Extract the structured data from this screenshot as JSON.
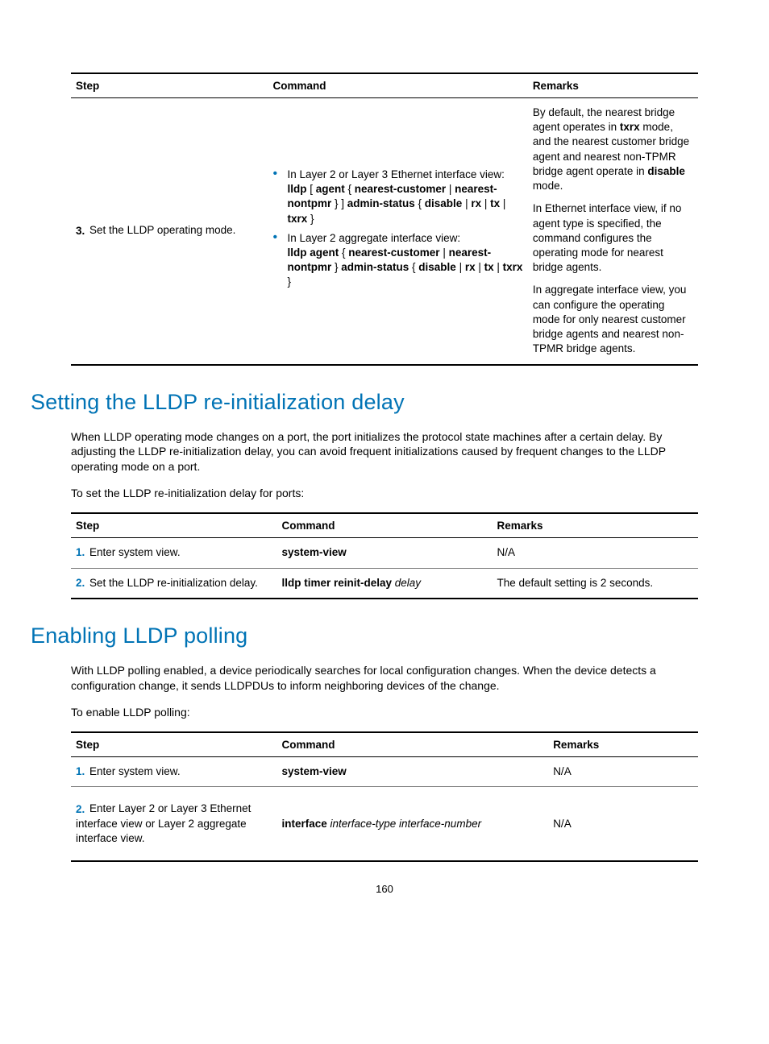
{
  "page_number": "160",
  "table1": {
    "headers": {
      "step": "Step",
      "command": "Command",
      "remarks": "Remarks"
    },
    "row": {
      "num": "3.",
      "step_text": "Set the LLDP operating mode.",
      "cmd_li1_pre": "In Layer 2 or Layer 3 Ethernet interface view:",
      "cmd_li1_code_a": "lldp",
      "cmd_li1_code_b": " [ ",
      "cmd_li1_code_c": "agent",
      "cmd_li1_code_d": " { ",
      "cmd_li1_code_e": "nearest-customer",
      "cmd_li1_code_f": " | ",
      "cmd_li1_code_g": "nearest-nontpmr",
      "cmd_li1_code_h": " } ] ",
      "cmd_li1_code_i": "admin-status",
      "cmd_li1_code_j": " { ",
      "cmd_li1_code_k": "disable",
      "cmd_li1_code_l": " | ",
      "cmd_li1_code_m": "rx",
      "cmd_li1_code_n": " | ",
      "cmd_li1_code_o": "tx",
      "cmd_li1_code_p": " | ",
      "cmd_li1_code_q": "txrx",
      "cmd_li1_code_r": " }",
      "cmd_li2_pre": "In Layer 2 aggregate interface view:",
      "cmd_li2_code_a": "lldp agent",
      "cmd_li2_code_b": " { ",
      "cmd_li2_code_c": "nearest-customer",
      "cmd_li2_code_d": " | ",
      "cmd_li2_code_e": "nearest-nontpmr",
      "cmd_li2_code_f": " } ",
      "cmd_li2_code_g": "admin-status",
      "cmd_li2_code_h": " { ",
      "cmd_li2_code_i": "disable",
      "cmd_li2_code_j": " | ",
      "cmd_li2_code_k": "rx",
      "cmd_li2_code_l": " | ",
      "cmd_li2_code_m": "tx",
      "cmd_li2_code_n": " | ",
      "cmd_li2_code_o": "txrx",
      "cmd_li2_code_p": " }",
      "rem_p1_a": "By default, the nearest bridge agent operates in ",
      "rem_p1_b": "txrx",
      "rem_p1_c": " mode, and the nearest customer bridge agent and nearest non-TPMR bridge agent operate in ",
      "rem_p1_d": "disable",
      "rem_p1_e": " mode.",
      "rem_p2": "In Ethernet interface view, if no agent type is specified, the command configures the operating mode for nearest bridge agents.",
      "rem_p3": "In aggregate interface view, you can configure the operating mode for only nearest customer bridge agents and nearest non-TPMR bridge agents."
    }
  },
  "section1": {
    "heading": "Setting the LLDP re-initialization delay",
    "para1": "When LLDP operating mode changes on a port, the port initializes the protocol state machines after a certain delay. By adjusting the LLDP re-initialization delay, you can avoid frequent initializations caused by frequent changes to the LLDP operating mode on a port.",
    "para2": "To set the LLDP re-initialization delay for ports:",
    "table": {
      "headers": {
        "step": "Step",
        "command": "Command",
        "remarks": "Remarks"
      },
      "rows": [
        {
          "num": "1.",
          "step_text": "Enter system view.",
          "command_bold": "system-view",
          "remarks": "N/A"
        },
        {
          "num": "2.",
          "step_text": "Set the LLDP re-initialization delay.",
          "command_bold": "lldp timer reinit-delay",
          "command_italic": " delay",
          "remarks": "The default setting is 2 seconds."
        }
      ]
    }
  },
  "section2": {
    "heading": "Enabling LLDP polling",
    "para1": "With LLDP polling enabled, a device periodically searches for local configuration changes. When the device detects a configuration change, it sends LLDPDUs to inform neighboring devices of the change.",
    "para2": "To enable LLDP polling:",
    "table": {
      "headers": {
        "step": "Step",
        "command": "Command",
        "remarks": "Remarks"
      },
      "rows": [
        {
          "num": "1.",
          "step_text": "Enter system view.",
          "command_bold": "system-view",
          "remarks": "N/A"
        },
        {
          "num": "2.",
          "step_text": "Enter Layer 2 or Layer 3 Ethernet interface view or Layer 2 aggregate interface view.",
          "command_bold": "interface",
          "command_italic": " interface-type interface-number",
          "remarks": "N/A"
        }
      ]
    }
  }
}
